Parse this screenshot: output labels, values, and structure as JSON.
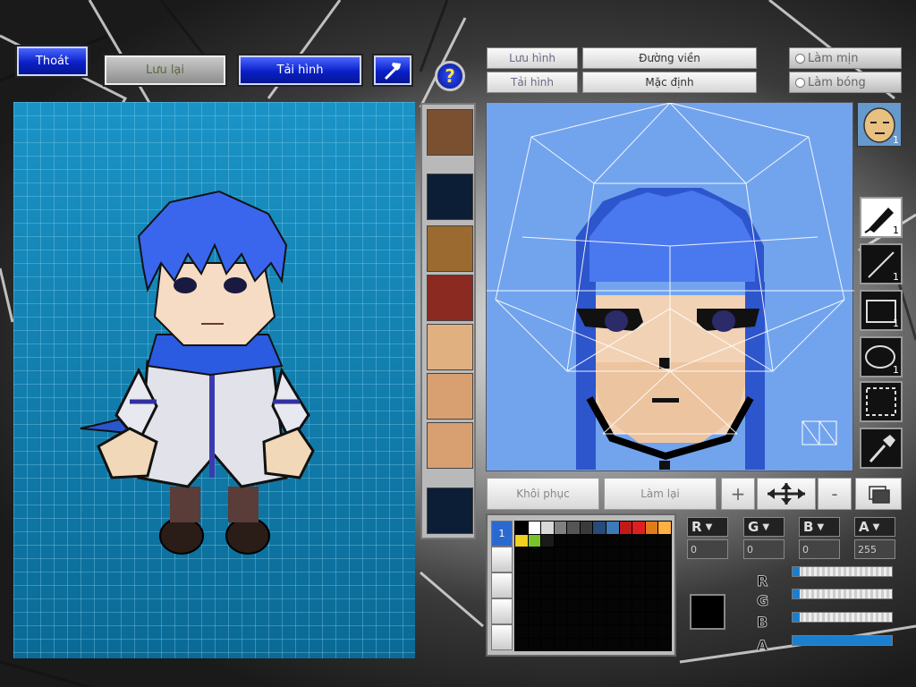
{
  "toolbar": {
    "exit_label": "Thoát",
    "save_label": "Lưu lại",
    "reload_label": "Tải hình"
  },
  "editor_tabs": {
    "save_image": "Lưu hình",
    "load_image": "Tải hình",
    "outline": "Đường viền",
    "default": "Mặc định",
    "smooth": "Làm mịn",
    "shade": "Làm bóng"
  },
  "actions": {
    "restore": "Khôi phục",
    "redo": "Làm lại",
    "plus": "+",
    "minus": "-"
  },
  "tools": [
    {
      "name": "pen",
      "count": "1"
    },
    {
      "name": "line",
      "count": "1"
    },
    {
      "name": "rectangle",
      "count": "1"
    },
    {
      "name": "ellipse",
      "count": "1"
    },
    {
      "name": "selection",
      "count": ""
    },
    {
      "name": "eyedropper",
      "count": ""
    }
  ],
  "face_preview_count": "1",
  "palette": {
    "tab_index": "1",
    "colors": [
      "#000000",
      "#ffffff",
      "#d9d9d9",
      "#808080",
      "#555555",
      "#3a3a3a",
      "#254c7a",
      "#3e79b8",
      "#c01a1a",
      "#e02020",
      "#e07a1a",
      "#ffb040",
      "#f2d020",
      "#77c42a",
      "#1a1a1a"
    ]
  },
  "color_channels": {
    "r": {
      "label": "R",
      "value": "0"
    },
    "g": {
      "label": "G",
      "value": "0"
    },
    "b": {
      "label": "B",
      "value": "0"
    },
    "a": {
      "label": "A",
      "value": "255"
    }
  },
  "current_color": "#000000",
  "slider_levels": {
    "r": 0.0,
    "g": 0.0,
    "b": 0.0,
    "a": 1.0
  }
}
